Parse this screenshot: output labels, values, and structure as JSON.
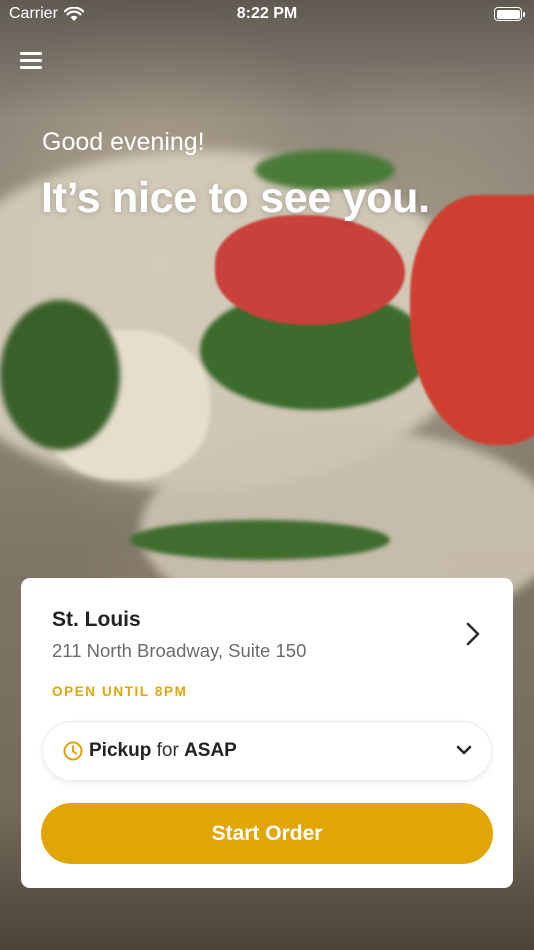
{
  "status_bar": {
    "carrier": "Carrier",
    "time": "8:22 PM"
  },
  "greeting": {
    "salutation": "Good evening!",
    "headline": "It’s nice to see you."
  },
  "location": {
    "name": "St. Louis",
    "address": "211 North Broadway, Suite 150",
    "hours": "OPEN UNTIL 8PM"
  },
  "order_mode": {
    "method": "Pickup",
    "connector": "for",
    "time": "ASAP"
  },
  "actions": {
    "start_order_label": "Start Order"
  },
  "colors": {
    "accent": "#e1a606",
    "card_background": "#ffffff"
  },
  "icons": {
    "menu": "hamburger-menu-icon",
    "wifi": "wifi-icon",
    "battery": "battery-icon",
    "location_chevron": "chevron-right-icon",
    "clock": "clock-icon",
    "dropdown": "chevron-down-icon"
  }
}
